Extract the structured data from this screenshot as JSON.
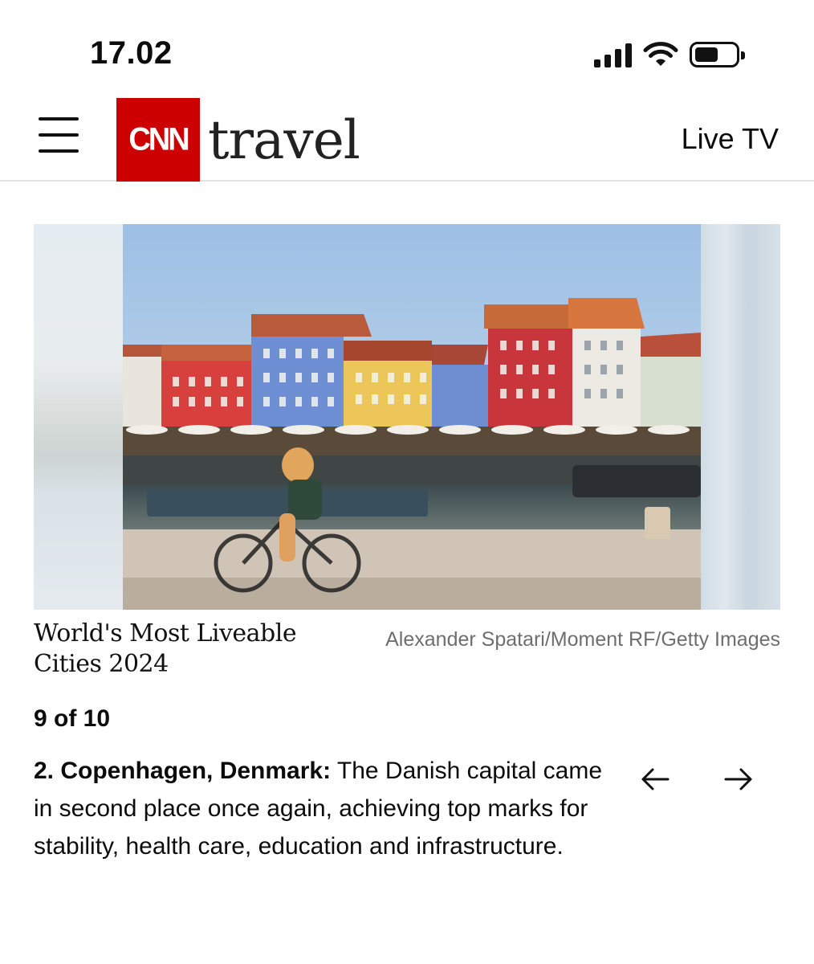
{
  "status_bar": {
    "time": "17.02",
    "icons": [
      "cellular-signal-icon",
      "wifi-icon",
      "battery-icon"
    ],
    "battery_level": 0.55
  },
  "header": {
    "brand_logo": "CNN",
    "section": "travel",
    "live_tv_label": "Live TV",
    "brand_color": "#cc0000"
  },
  "gallery": {
    "image_alt": "Cyclist riding past colorful waterfront houses in Nyhavn, Copenhagen",
    "caption_title": "World's Most Liveable Cities 2024",
    "credit": "Alexander Spatari/Moment RF/Getty Images",
    "counter": "9 of 10",
    "slide_heading": "2. Copenhagen, Denmark:",
    "slide_text": " The Danish capital came in second place once again, achieving top marks for stability, health care, education and infrastructure.",
    "prev_icon": "arrow-left-icon",
    "next_icon": "arrow-right-icon"
  }
}
